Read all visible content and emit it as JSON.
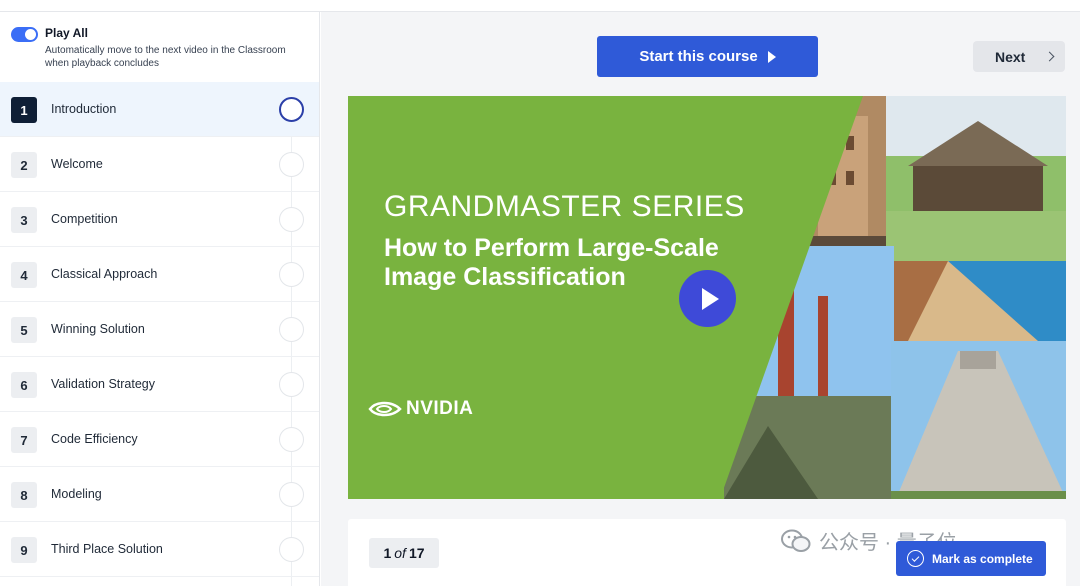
{
  "sidebar": {
    "play_all": {
      "enabled": true,
      "title": "Play All",
      "description": "Automatically move to the next video in the Classroom when playback concludes"
    },
    "lessons": [
      {
        "number": "1",
        "title": "Introduction",
        "active": true
      },
      {
        "number": "2",
        "title": "Welcome"
      },
      {
        "number": "3",
        "title": "Competition"
      },
      {
        "number": "4",
        "title": "Classical Approach"
      },
      {
        "number": "5",
        "title": "Winning Solution"
      },
      {
        "number": "6",
        "title": "Validation Strategy"
      },
      {
        "number": "7",
        "title": "Code Efficiency"
      },
      {
        "number": "8",
        "title": "Modeling"
      },
      {
        "number": "9",
        "title": "Third Place Solution"
      }
    ]
  },
  "header": {
    "start_label": "Start this course",
    "next_label": "Next"
  },
  "video": {
    "series": "GRANDMASTER SERIES",
    "title": "How to Perform Large-Scale Image Classification",
    "brand": "NVIDIA",
    "accent_color": "#79b33f",
    "play_color": "#3e4ad8"
  },
  "footer": {
    "pager": {
      "current": "1",
      "of": "of",
      "total": "17"
    },
    "complete_label": "Mark as complete",
    "watermark": "公众号 · 量子位"
  },
  "colors": {
    "primary": "#2f5ad8",
    "active_number": "#0f1f36"
  }
}
